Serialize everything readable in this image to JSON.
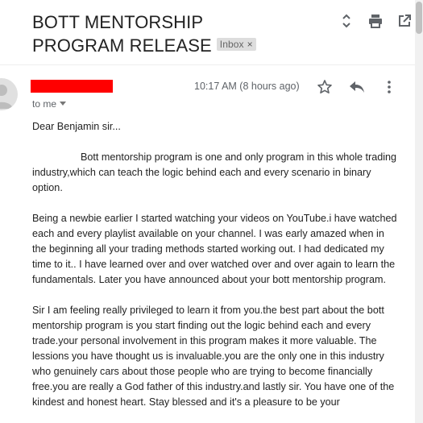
{
  "email": {
    "subject": "BOTT MENTORSHIP PROGRAM RELEASE",
    "label_badge": "Inbox",
    "label_close": "×",
    "time": "10:17 AM (8 hours ago)",
    "recipient": "to me",
    "greeting": "Dear Benjamin sir...",
    "paragraph1": "Bott mentorship program is one and only program in this whole trading industry,which can teach the logic behind each and every scenario in binary option.",
    "paragraph2": " Being a newbie earlier I started watching your videos on YouTube.i have watched each and every playlist available on your channel. I was early amazed when in the beginning all your trading methods started working out. I had dedicated my time to it.. I have learned over and over watched over and over again to learn the fundamentals. Later you have announced about your bott mentorship program.",
    "paragraph3": "Sir I am feeling really privileged to learn it from you.the best part about the bott mentorship program is you start finding out the logic behind each and every trade.your personal involvement in this program makes it more valuable. The lessions you have thought us is invaluable.you are the only one in this industry who genuinely cars about those people who are trying to become financially free.you are really a God father of this industry.and lastly sir. You have one of the kindest and honest heart. Stay blessed and it's a pleasure to be your"
  },
  "icons": {
    "expand": "unfold-icon",
    "print": "print-icon",
    "popout": "open-new-window-icon",
    "star": "star-icon",
    "reply": "reply-icon",
    "more": "more-vert-icon"
  },
  "colors": {
    "redaction": "#ff0000",
    "badge_bg": "#dddddd",
    "icon_gray": "#5f6368"
  }
}
